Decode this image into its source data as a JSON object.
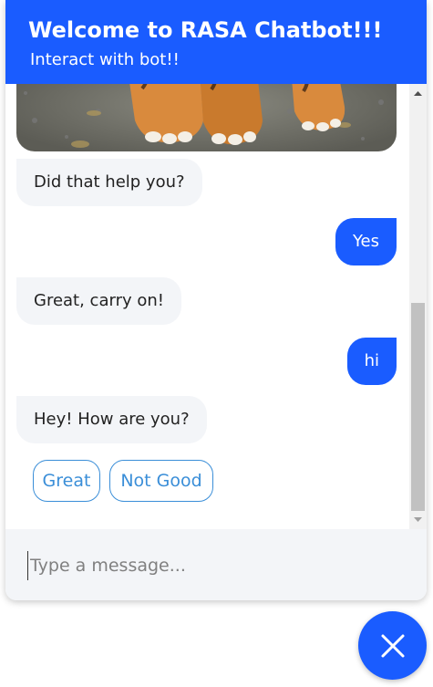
{
  "header": {
    "title": "Welcome to RASA Chatbot!!!",
    "subtitle": "Interact with bot!!"
  },
  "messages": [
    {
      "sender": "bot",
      "text": "Did that help you?"
    },
    {
      "sender": "user",
      "text": "Yes"
    },
    {
      "sender": "bot",
      "text": "Great, carry on!"
    },
    {
      "sender": "user",
      "text": "hi"
    },
    {
      "sender": "bot",
      "text": "Hey! How are you?"
    }
  ],
  "quick_replies": [
    "Great",
    "Not Good"
  ],
  "composer": {
    "placeholder": "Type a message..."
  },
  "icons": {
    "close": "close-icon",
    "scroll_up": "scroll-up-arrow-icon",
    "scroll_down": "scroll-down-arrow-icon"
  },
  "colors": {
    "brand": "#1a5cff",
    "bot_bubble": "#f3f5f8",
    "quick_reply": "#3a8ed8"
  },
  "scroll": {
    "position_fraction": 0.95
  }
}
